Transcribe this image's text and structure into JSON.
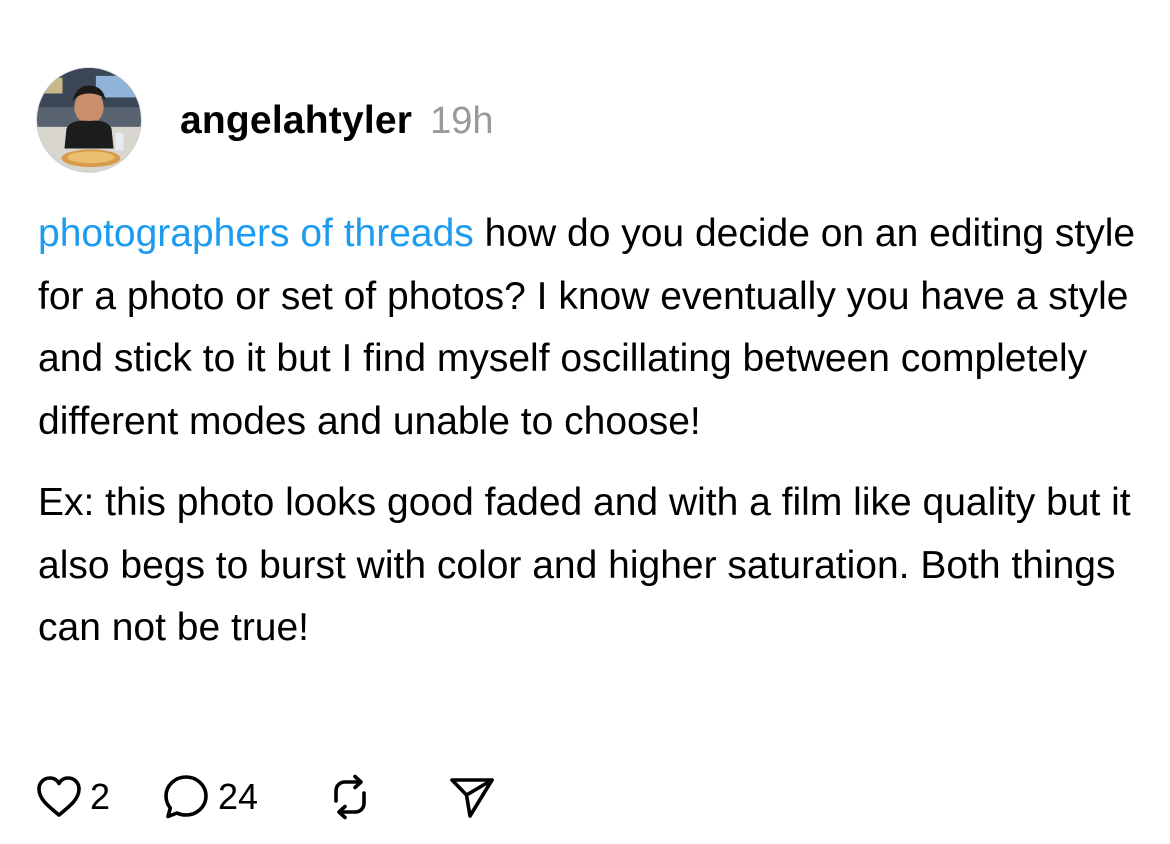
{
  "post": {
    "username": "angelahtyler",
    "time": "19h",
    "tag": "photographers of threads",
    "paragraph1_rest": " how do you decide on an editing style for a photo or set of photos? I know eventually you have a style and stick to it but I find myself oscillating between completely different modes and unable to choose!",
    "paragraph2": "Ex: this photo looks good faded and with a film like quality but it also begs to burst with color and higher saturation. Both things can not be true!"
  },
  "actions": {
    "likes": "2",
    "replies": "24"
  },
  "icons": {
    "like": "heart-icon",
    "reply": "comment-bubble-icon",
    "repost": "repost-icon",
    "share": "send-icon"
  },
  "colors": {
    "tag": "#1d9bf0",
    "time": "#999999",
    "text": "#000000"
  }
}
